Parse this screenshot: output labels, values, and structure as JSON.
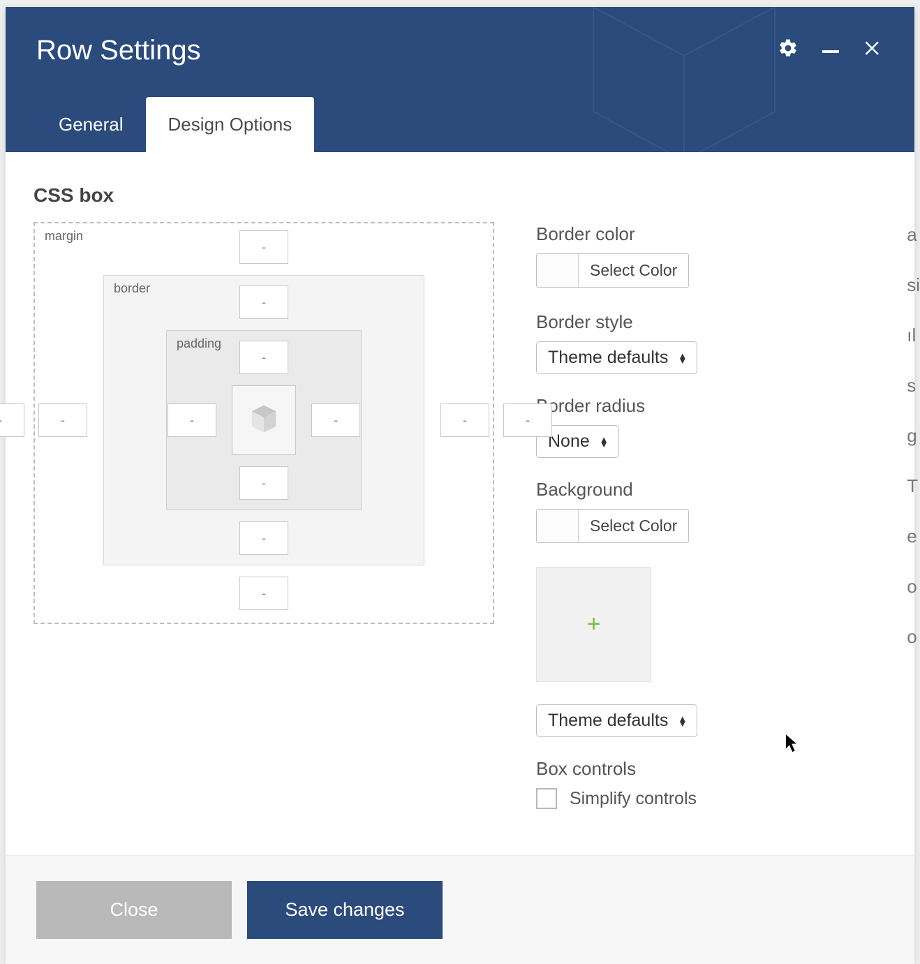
{
  "modal": {
    "title": "Row Settings",
    "tabs": {
      "general": "General",
      "design": "Design Options",
      "active": "design"
    }
  },
  "cssbox": {
    "heading": "CSS box",
    "labels": {
      "margin": "margin",
      "border": "border",
      "padding": "padding"
    },
    "placeholder": "-"
  },
  "fields": {
    "border_color": {
      "label": "Border color",
      "button": "Select Color"
    },
    "border_style": {
      "label": "Border style",
      "value": "Theme defaults"
    },
    "border_radius": {
      "label": "Border radius",
      "value": "None"
    },
    "background": {
      "label": "Background",
      "button": "Select Color"
    },
    "bg_style": {
      "value": "Theme defaults"
    },
    "box_controls": {
      "label": "Box controls",
      "checkbox": "Simplify controls"
    }
  },
  "footer": {
    "close": "Close",
    "save": "Save changes"
  }
}
